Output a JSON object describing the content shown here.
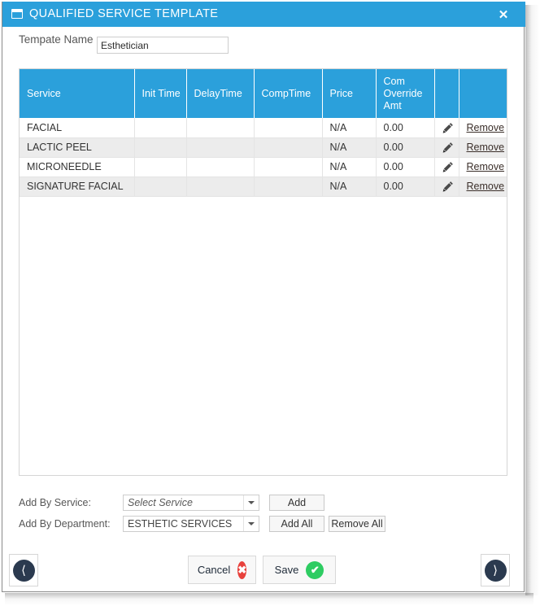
{
  "window": {
    "title": "QUALIFIED SERVICE TEMPLATE",
    "title_icon": "window-icon",
    "close_label": "✕",
    "accent_color": "#2ba0db"
  },
  "form": {
    "template_name_label": "Tempate Name",
    "template_name_value": "Esthetician",
    "template_name_placeholder": ""
  },
  "grid": {
    "columns": [
      "Service",
      "Init Time",
      "DelayTime",
      "CompTime",
      "Price",
      "Com Override Amt",
      "",
      ""
    ],
    "rows": [
      {
        "service": "FACIAL",
        "init_time": "",
        "delay_time": "",
        "comp_time": "",
        "price": "N/A",
        "com_override_amt": "0.00",
        "edit_icon": "pencil-icon",
        "remove_label": "Remove"
      },
      {
        "service": "LACTIC PEEL",
        "init_time": "",
        "delay_time": "",
        "comp_time": "",
        "price": "N/A",
        "com_override_amt": "0.00",
        "edit_icon": "pencil-icon",
        "remove_label": "Remove"
      },
      {
        "service": "MICRONEEDLE",
        "init_time": "",
        "delay_time": "",
        "comp_time": "",
        "price": "N/A",
        "com_override_amt": "0.00",
        "edit_icon": "pencil-icon",
        "remove_label": "Remove"
      },
      {
        "service": "SIGNATURE FACIAL",
        "init_time": "",
        "delay_time": "",
        "comp_time": "",
        "price": "N/A",
        "com_override_amt": "0.00",
        "edit_icon": "pencil-icon",
        "remove_label": "Remove"
      }
    ]
  },
  "add_controls": {
    "by_service": {
      "label": "Add By Service:",
      "selected": "Select Service",
      "is_placeholder": true,
      "button_label": "Add"
    },
    "by_department": {
      "label": "Add By Department:",
      "selected": "ESTHETIC SERVICES",
      "is_placeholder": false,
      "add_all_label": "Add All",
      "remove_all_label": "Remove All"
    }
  },
  "footer": {
    "prev_icon": "chevron-left-icon",
    "next_icon": "chevron-right-icon",
    "cancel_label": "Cancel",
    "cancel_badge": "✖",
    "save_label": "Save",
    "save_badge": "✔"
  }
}
